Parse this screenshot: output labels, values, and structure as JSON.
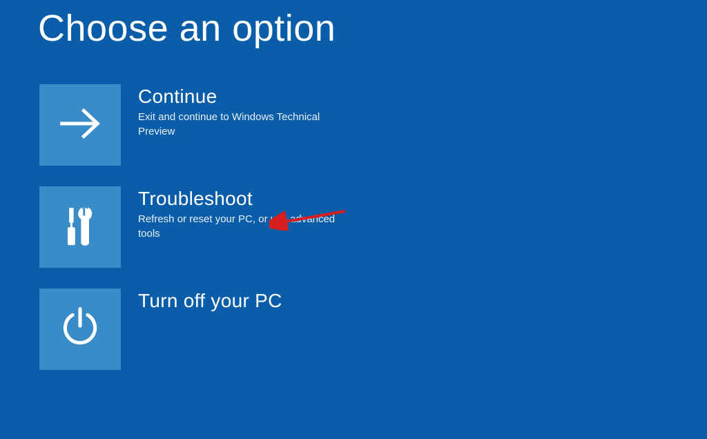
{
  "title": "Choose an option",
  "options": [
    {
      "icon": "arrow-right",
      "label": "Continue",
      "description": "Exit and continue to Windows Technical Preview"
    },
    {
      "icon": "tools",
      "label": "Troubleshoot",
      "description": "Refresh or reset your PC, or use advanced tools"
    },
    {
      "icon": "power",
      "label": "Turn off your PC",
      "description": ""
    }
  ]
}
